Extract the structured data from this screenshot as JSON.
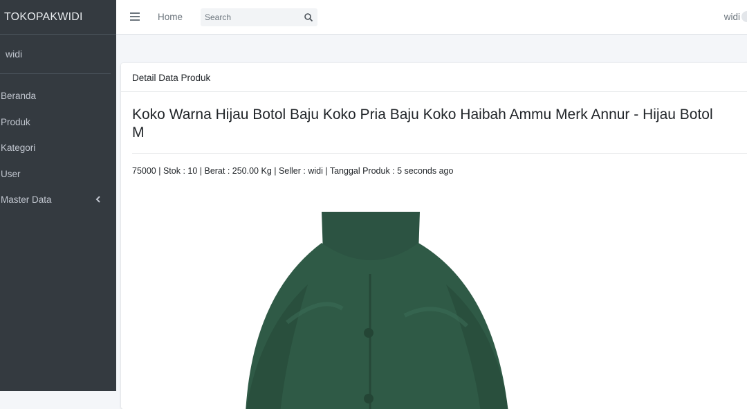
{
  "brand": "TOKOPAKWIDI",
  "sidebar": {
    "user": "widi",
    "items": [
      {
        "label": "Beranda"
      },
      {
        "label": "Produk"
      },
      {
        "label": "Kategori"
      },
      {
        "label": "User"
      },
      {
        "label": "Master Data"
      }
    ]
  },
  "topbar": {
    "home": "Home",
    "search_placeholder": "Search",
    "user": "widi"
  },
  "card": {
    "header": "Detail Data Produk",
    "title": "Koko Warna Hijau Botol Baju Koko Pria Baju Koko Haibah Ammu Merk Annur - Hijau Botol",
    "title_line2": "M",
    "meta": "75000 | Stok : 10 | Berat : 250.00 Kg | Seller : widi | Tanggal Produk : 5 seconds ago"
  },
  "colors": {
    "sidebar_bg": "#343a40",
    "page_bg": "#f4f6f9",
    "shirt": "#2f5a46"
  }
}
